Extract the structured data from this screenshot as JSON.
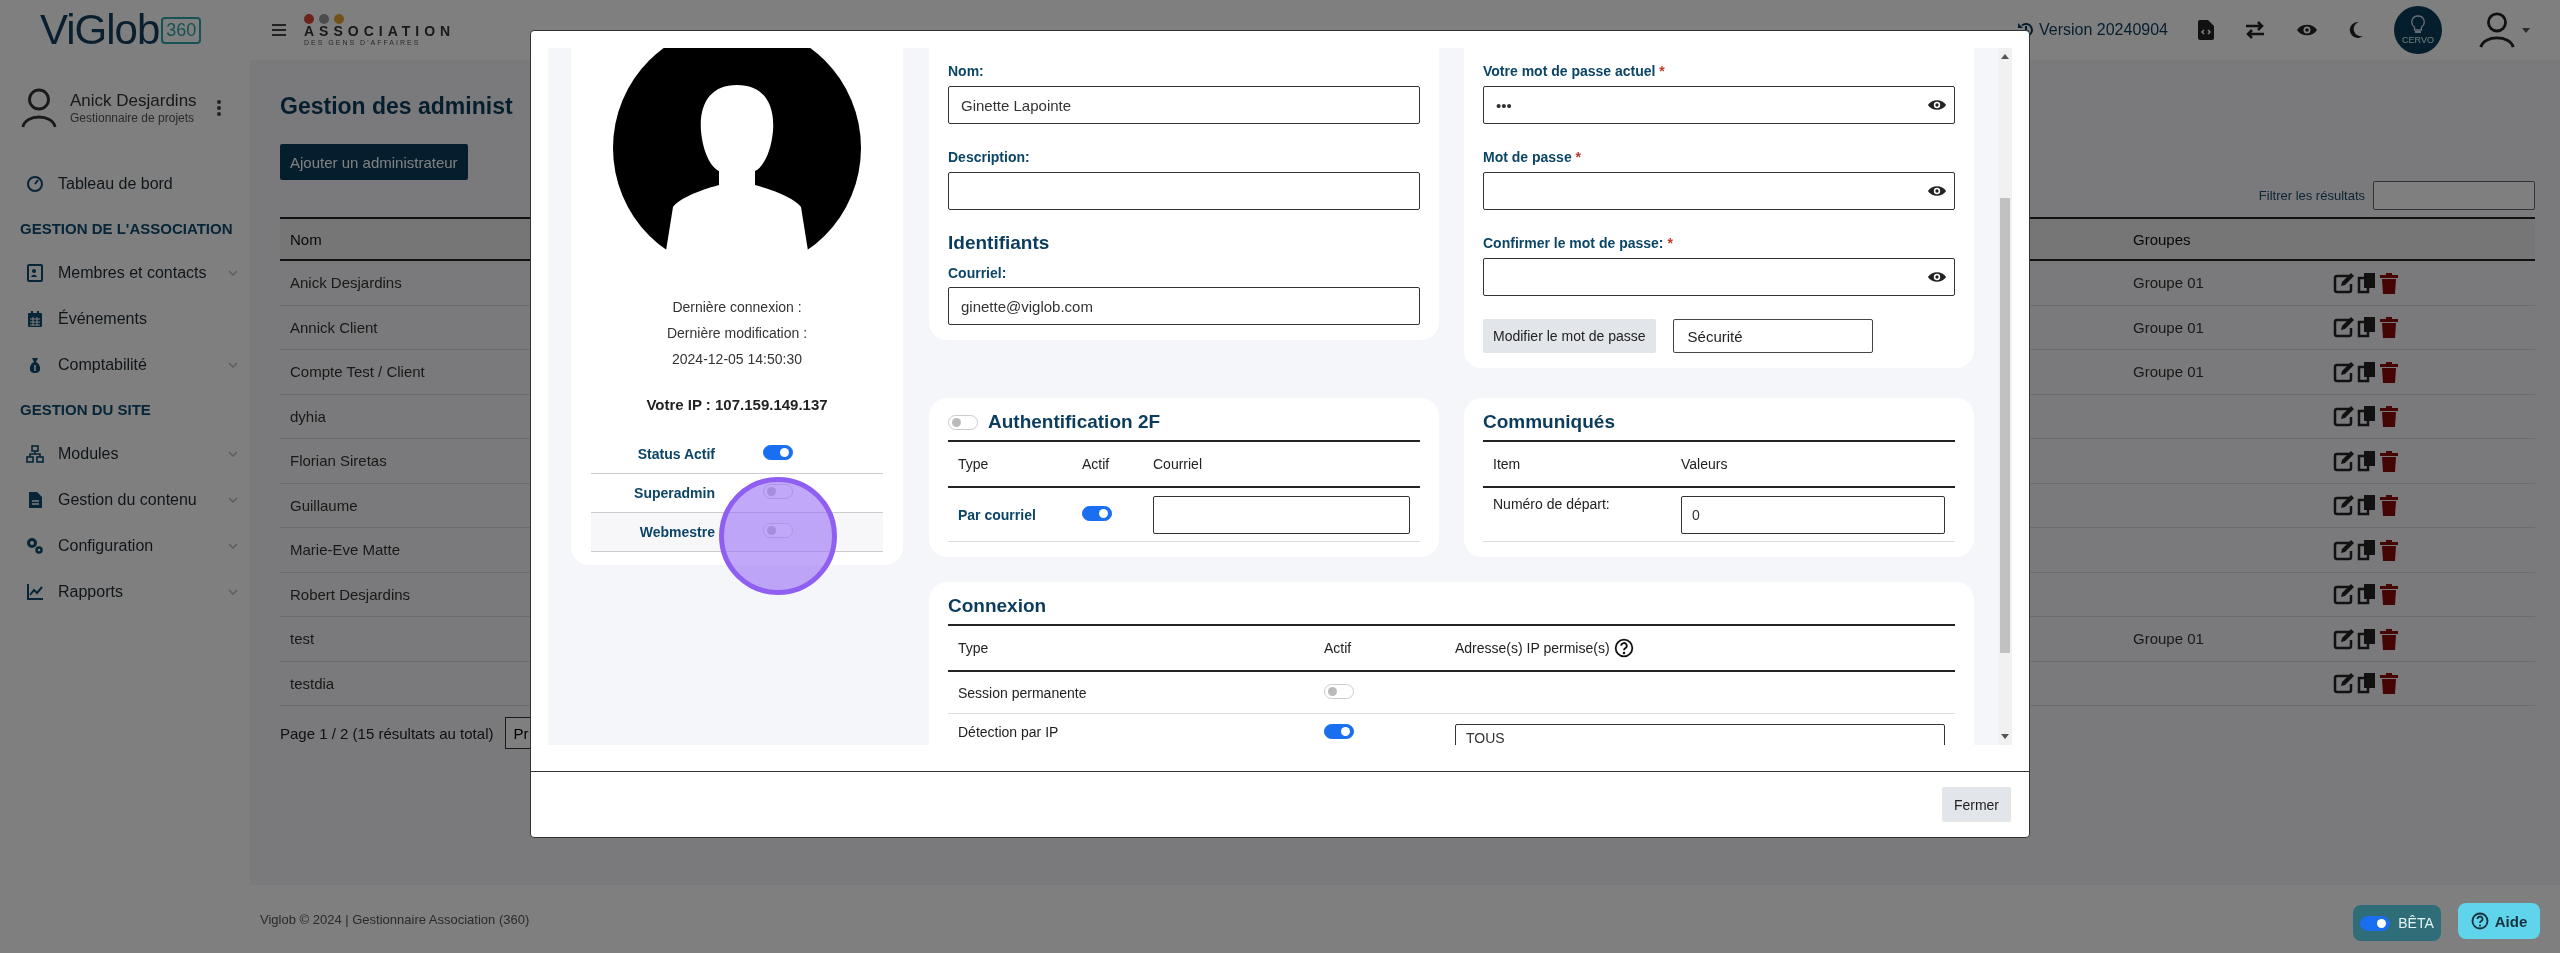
{
  "header": {
    "logo": "ViGlob",
    "logo_badge": "360",
    "org_name": "ASSOCIATION",
    "org_subtitle": "DES GENS D'AFFAIRES",
    "version": "Version 20240904",
    "assistant_label": "CERVO"
  },
  "sidebar": {
    "user": {
      "name": "Anick Desjardins",
      "role": "Gestionnaire de projets"
    },
    "items": [
      {
        "kind": "link",
        "label": "Tableau de bord",
        "expandable": false
      },
      {
        "kind": "section",
        "label": "GESTION DE L'ASSOCIATION"
      },
      {
        "kind": "link",
        "label": "Membres et contacts",
        "expandable": true
      },
      {
        "kind": "link",
        "label": "Événements",
        "expandable": false
      },
      {
        "kind": "link",
        "label": "Comptabilité",
        "expandable": true
      },
      {
        "kind": "section",
        "label": "GESTION DU SITE"
      },
      {
        "kind": "link",
        "label": "Modules",
        "expandable": true
      },
      {
        "kind": "link",
        "label": "Gestion du contenu",
        "expandable": true
      },
      {
        "kind": "link",
        "label": "Configuration",
        "expandable": true
      },
      {
        "kind": "link",
        "label": "Rapports",
        "expandable": true
      }
    ]
  },
  "page": {
    "title": "Gestion des administ",
    "add_button": "Ajouter un administrateur",
    "filter_label": "Filtrer les résultats",
    "table": {
      "columns": [
        "Nom",
        "Groupes"
      ],
      "rows": [
        {
          "name": "Anick Desjardins",
          "group": "Groupe 01"
        },
        {
          "name": "Annick Client",
          "group": "Groupe 01"
        },
        {
          "name": "Compte Test / Client",
          "group": "Groupe 01"
        },
        {
          "name": "dyhia"
        },
        {
          "name": "Florian Siretas"
        },
        {
          "name": "Guillaume"
        },
        {
          "name": "Marie-Eve Matte"
        },
        {
          "name": "Robert Desjardins"
        },
        {
          "name": "test",
          "group": "Groupe 01"
        },
        {
          "name": "testdia"
        }
      ]
    },
    "pagination": "Page 1 / 2 (15 résultats au total)",
    "prev_button": "Pr"
  },
  "footer": "Viglob © 2024 | Gestionnaire Association (360)",
  "beta": {
    "label": "BÊTA",
    "on": true
  },
  "help_button": "Aide",
  "modal": {
    "profile": {
      "last_login": "Dernière connexion :",
      "last_modified": "Dernière modification :",
      "modified_at": "2024-12-05 14:50:30",
      "ip": "Votre IP : 107.159.149.137",
      "flags": [
        {
          "label": "Status Actif",
          "on": true
        },
        {
          "label": "Superadmin",
          "on": false
        },
        {
          "label": "Webmestre",
          "on": false
        }
      ]
    },
    "identity": {
      "fields": [
        {
          "label": "Nom:",
          "value": "Ginette Lapointe"
        },
        {
          "label": "Description:"
        }
      ],
      "heading": "Identifiants",
      "email_label": "Courriel:",
      "email": "ginette@viglob.com"
    },
    "password": {
      "fields": [
        {
          "label": "Votre mot de passe actuel",
          "mark": "*",
          "value": "•••"
        },
        {
          "label": "Mot de passe",
          "mark": "*"
        },
        {
          "label": "Confirmer le mot de passe:",
          "mark": "*"
        }
      ],
      "change_button": "Modifier le mot de passe",
      "security": "Sécurité"
    },
    "two_factor": {
      "enabled": false,
      "title": "Authentification 2F",
      "columns": [
        "Type",
        "Actif",
        "Courriel"
      ],
      "rows": [
        {
          "type": "Par courriel",
          "active": true
        }
      ]
    },
    "communiques": {
      "title": "Communiqués",
      "columns": [
        "Item",
        "Valeurs"
      ],
      "rows": [
        {
          "item": "Numéro de départ:",
          "value": "0"
        }
      ]
    },
    "connexion": {
      "title": "Connexion",
      "columns": [
        "Type",
        "Actif",
        "Adresse(s) IP permise(s)"
      ],
      "rows": [
        {
          "type": "Session permanente",
          "active": false
        },
        {
          "type": "Détection par IP",
          "active": true,
          "ips": "TOUS"
        }
      ]
    },
    "close_button": "Fermer"
  }
}
